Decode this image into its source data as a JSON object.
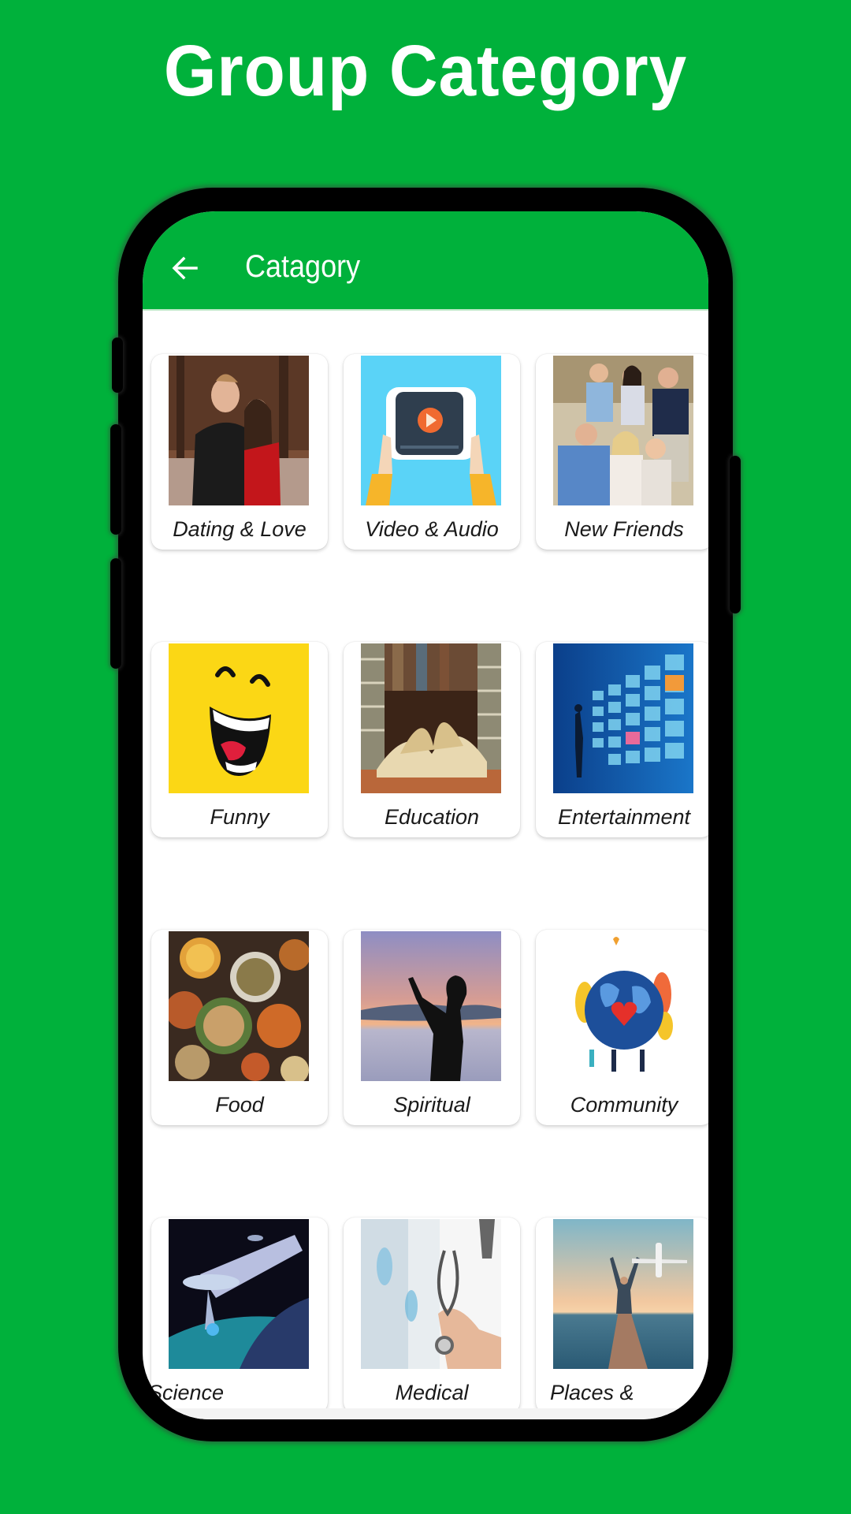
{
  "headline": "Group Category",
  "colors": {
    "brand_green": "#00b13b",
    "card_bg": "#ffffff",
    "text": "#1a1a1a"
  },
  "toolbar": {
    "back_icon": "arrow-left-icon",
    "title": "Catagory"
  },
  "categories": [
    {
      "label": "Dating & Love",
      "image": "couple-photo"
    },
    {
      "label": "Video & Audio",
      "image": "video-player-illustration"
    },
    {
      "label": "New Friends",
      "image": "group-of-friends-photo"
    },
    {
      "label": "Funny",
      "image": "laughing-face-illustration"
    },
    {
      "label": "Education",
      "image": "open-books-photo"
    },
    {
      "label": "Entertainment",
      "image": "video-wall-photo"
    },
    {
      "label": "Food",
      "image": "dishes-table-photo"
    },
    {
      "label": "Spiritual",
      "image": "silhouette-sunset-photo"
    },
    {
      "label": "Community",
      "image": "globe-heart-illustration"
    },
    {
      "label": "Science",
      "image": "spaceship-earth-photo"
    },
    {
      "label": "Medical",
      "image": "doctor-stethoscope-photo"
    },
    {
      "label": "Places &",
      "image": "traveler-airplane-photo"
    }
  ]
}
